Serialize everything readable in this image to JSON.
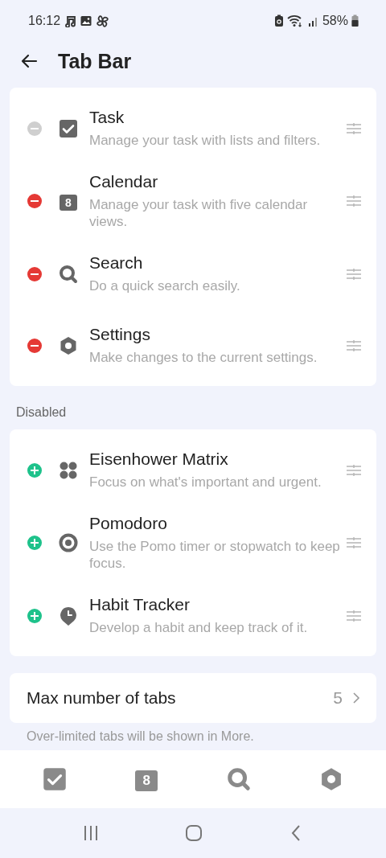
{
  "status_bar": {
    "time": "16:12",
    "battery": "58%"
  },
  "header": {
    "title": "Tab Bar"
  },
  "sections": [
    {
      "kind": "enabled",
      "items": [
        {
          "kind": "task",
          "title": "Task",
          "description": "Manage your task with lists and filters.",
          "disabled": true
        },
        {
          "kind": "calendar",
          "date": "8",
          "title": "Calendar",
          "description": "Manage your task with five calendar views.",
          "disabled": false
        },
        {
          "kind": "search",
          "title": "Search",
          "description": "Do a quick search easily.",
          "disabled": false
        },
        {
          "kind": "settings",
          "title": "Settings",
          "description": "Make changes to the current settings.",
          "disabled": false
        }
      ]
    },
    {
      "label": "Disabled",
      "kind": "disabled",
      "items": [
        {
          "kind": "matrix",
          "title": "Eisenhower Matrix",
          "description": "Focus on what's important and urgent.",
          "disabled": false
        },
        {
          "kind": "pomodoro",
          "title": "Pomodoro",
          "description": "Use the Pomo timer or stopwatch to keep focus.",
          "disabled": false
        },
        {
          "kind": "habit",
          "title": "Habit Tracker",
          "description": "Develop a habit and keep track of it.",
          "disabled": false
        }
      ]
    }
  ],
  "max_tabs": {
    "label": "Max number of tabs",
    "value": "5",
    "note": "Over-limited tabs will be shown in More."
  },
  "tab_bar": [
    {
      "kind": "task"
    },
    {
      "kind": "calendar",
      "date": "8"
    },
    {
      "kind": "search"
    },
    {
      "kind": "settings"
    }
  ]
}
